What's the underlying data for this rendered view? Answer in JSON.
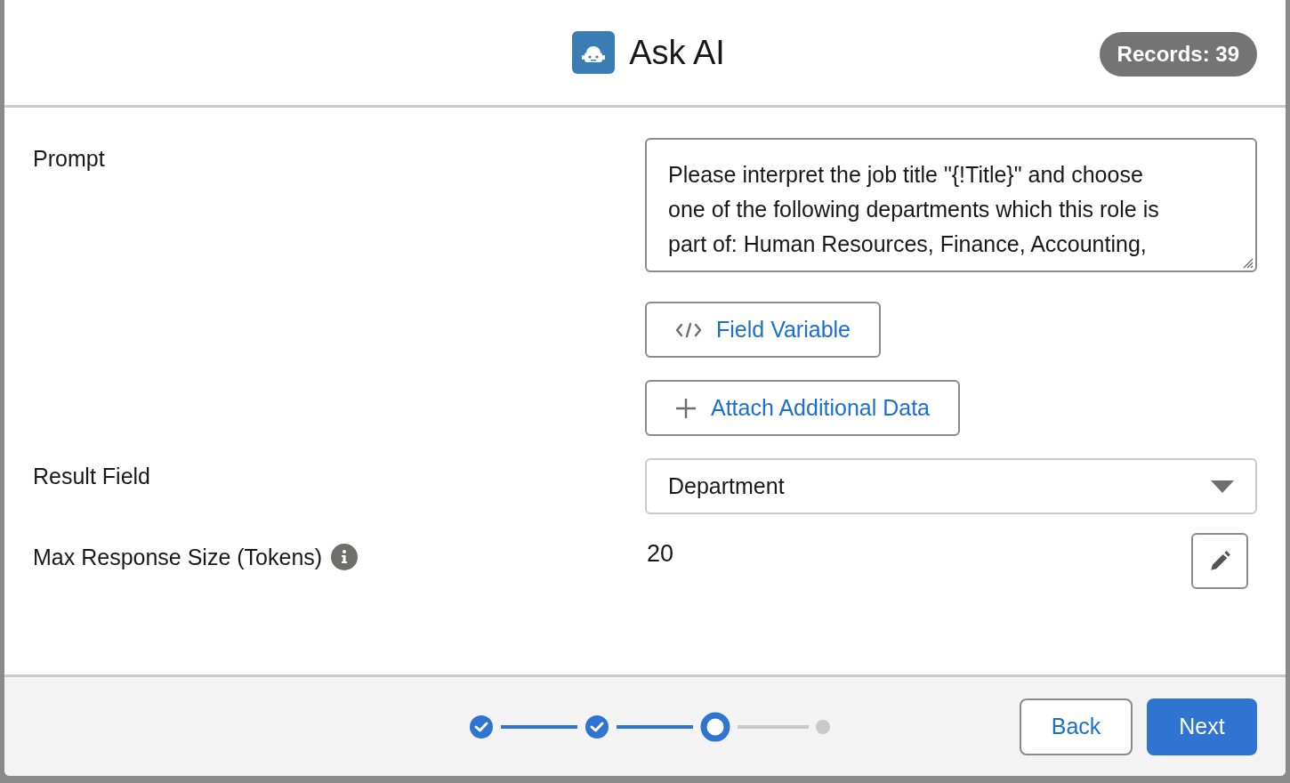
{
  "header": {
    "title": "Ask AI",
    "badge": "Records: 39"
  },
  "prompt": {
    "label": "Prompt",
    "lines": [
      "Please interpret the job title \"{!Title}\" and choose",
      "one of the following departments which this role is",
      "part of: Human Resources, Finance, Accounting,"
    ]
  },
  "prompt_buttons": [
    {
      "kind": "code",
      "label": "Field Variable"
    },
    {
      "kind": "add",
      "label": "Attach Additional Data"
    }
  ],
  "result_field": {
    "label": "Result Field",
    "value": "Department"
  },
  "max_response": {
    "label": "Max Response Size (Tokens)",
    "value": "20"
  },
  "steps": [
    {
      "complete": true,
      "selected": false
    },
    {
      "complete": true,
      "selected": false
    },
    {
      "complete": false,
      "selected": true
    },
    {
      "complete": false,
      "selected": false
    }
  ],
  "buttons": {
    "back": "Back",
    "next": "Next"
  }
}
